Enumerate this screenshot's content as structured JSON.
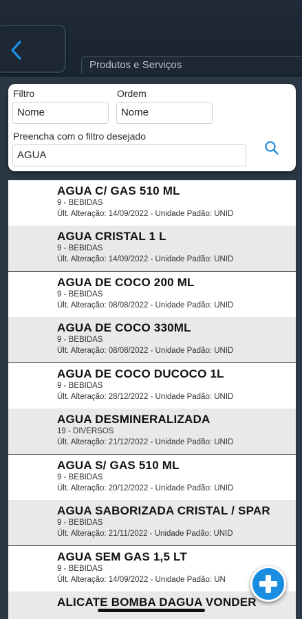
{
  "header": {
    "title": "Produtos e Serviços",
    "back_icon": "chevron-left-icon"
  },
  "filter": {
    "filtro_label": "Filtro",
    "filtro_value": "Nome",
    "ordem_label": "Ordem",
    "ordem_value": "Nome",
    "search_label": "Preencha com o filtro desejado",
    "search_value": "AGUA",
    "search_icon": "search-icon"
  },
  "products": [
    {
      "name": "AGUA C/ GAS 510 ML",
      "category": "9 - BEBIDAS",
      "updated": "Últ. Alteração: 14/09/2022 - Unidade Padão: UNID"
    },
    {
      "name": "AGUA CRISTAL 1 L",
      "category": "9 - BEBIDAS",
      "updated": "Últ. Alteração: 14/09/2022 - Unidade Padão: UNID"
    },
    {
      "name": "AGUA DE COCO 200 ML",
      "category": "9 - BEBIDAS",
      "updated": "Últ. Alteração: 08/08/2022 - Unidade Padão: UNID"
    },
    {
      "name": "AGUA DE COCO 330ML",
      "category": "9 - BEBIDAS",
      "updated": "Últ. Alteração: 08/08/2022 - Unidade Padão: UNID"
    },
    {
      "name": "AGUA DE COCO DUCOCO 1L",
      "category": "9 - BEBIDAS",
      "updated": "Últ. Alteração: 28/12/2022 - Unidade Padão: UNID"
    },
    {
      "name": "AGUA DESMINERALIZADA",
      "category": "19 - DIVERSOS",
      "updated": "Últ. Alteração: 21/12/2022 - Unidade Padão: UNID"
    },
    {
      "name": "AGUA S/ GAS 510 ML",
      "category": "9 - BEBIDAS",
      "updated": "Últ. Alteração: 20/12/2022 - Unidade Padão: UNID"
    },
    {
      "name": "AGUA SABORIZADA CRISTAL /  SPAR",
      "category": "9 - BEBIDAS",
      "updated": "Últ. Alteração: 21/11/2022 - Unidade Padão: UNID"
    },
    {
      "name": "AGUA SEM GAS 1,5 LT",
      "category": "9 - BEBIDAS",
      "updated": "Últ. Alteração: 14/09/2022 - Unidade Padão: UN"
    },
    {
      "name": "ALICATE BOMBA DAGUA VONDER",
      "category": "",
      "updated": ""
    }
  ],
  "fab": {
    "icon": "plus-icon"
  },
  "colors": {
    "accent": "#1a8de0",
    "header_bg": "#1e2a36",
    "row_alt": "#e9e9e9"
  }
}
